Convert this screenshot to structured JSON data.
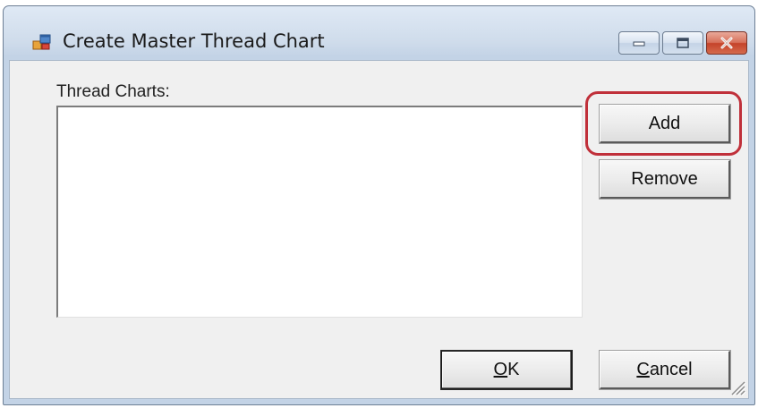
{
  "window": {
    "title": "Create Master Thread Chart",
    "icon": "app-form-icon",
    "caption_buttons": [
      "minimize-icon",
      "maximize-icon",
      "close-icon"
    ]
  },
  "form": {
    "list_label": "Thread Charts:",
    "list_items": [],
    "buttons": {
      "add": "Add",
      "remove": "Remove",
      "ok": "OK",
      "cancel": "Cancel"
    },
    "highlight_color": "#c0303a"
  }
}
